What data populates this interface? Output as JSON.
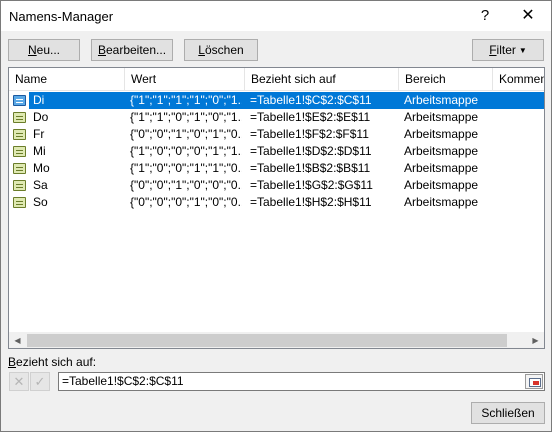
{
  "window": {
    "title": "Namens-Manager",
    "help_glyph": "?",
    "close_glyph": "✕"
  },
  "toolbar": {
    "new_label_mnemonic": "N",
    "new_label_rest": "eu...",
    "edit_label_mnemonic": "B",
    "edit_label_rest": "earbeiten...",
    "delete_label_mnemonic": "L",
    "delete_label_rest": "öschen",
    "filter_label_mnemonic": "F",
    "filter_label_rest": "ilter",
    "filter_caret": "▼"
  },
  "list": {
    "columns": [
      "Name",
      "Wert",
      "Bezieht sich auf",
      "Bereich",
      "Kommentar"
    ],
    "rows": [
      {
        "name": "Di",
        "wert": "{\"1\";\"1\";\"1\";\"1\";\"0\";\"1...",
        "ref": "=Tabelle1!$C$2:$C$11",
        "bereich": "Arbeitsmappe",
        "selected": true
      },
      {
        "name": "Do",
        "wert": "{\"1\";\"1\";\"0\";\"1\";\"0\";\"1...",
        "ref": "=Tabelle1!$E$2:$E$11",
        "bereich": "Arbeitsmappe",
        "selected": false
      },
      {
        "name": "Fr",
        "wert": "{\"0\";\"0\";\"1\";\"0\";\"1\";\"0...",
        "ref": "=Tabelle1!$F$2:$F$11",
        "bereich": "Arbeitsmappe",
        "selected": false
      },
      {
        "name": "Mi",
        "wert": "{\"1\";\"0\";\"0\";\"0\";\"1\";\"1...",
        "ref": "=Tabelle1!$D$2:$D$11",
        "bereich": "Arbeitsmappe",
        "selected": false
      },
      {
        "name": "Mo",
        "wert": "{\"1\";\"0\";\"0\";\"1\";\"1\";\"0...",
        "ref": "=Tabelle1!$B$2:$B$11",
        "bereich": "Arbeitsmappe",
        "selected": false
      },
      {
        "name": "Sa",
        "wert": "{\"0\";\"0\";\"1\";\"0\";\"0\";\"0...",
        "ref": "=Tabelle1!$G$2:$G$11",
        "bereich": "Arbeitsmappe",
        "selected": false
      },
      {
        "name": "So",
        "wert": "{\"0\";\"0\";\"0\";\"1\";\"0\";\"0...",
        "ref": "=Tabelle1!$H$2:$H$11",
        "bereich": "Arbeitsmappe",
        "selected": false
      }
    ],
    "scroll_left_glyph": "◀",
    "scroll_right_glyph": "▶"
  },
  "reference": {
    "label_mnemonic": "B",
    "label_rest": "ezieht sich auf:",
    "value": "=Tabelle1!$C$2:$C$11",
    "cancel_glyph": "✕",
    "confirm_glyph": "✓"
  },
  "footer": {
    "close_label": "Schließen"
  },
  "colors": {
    "selection": "#0078d7",
    "dialog_bg": "#f0f0f0"
  }
}
